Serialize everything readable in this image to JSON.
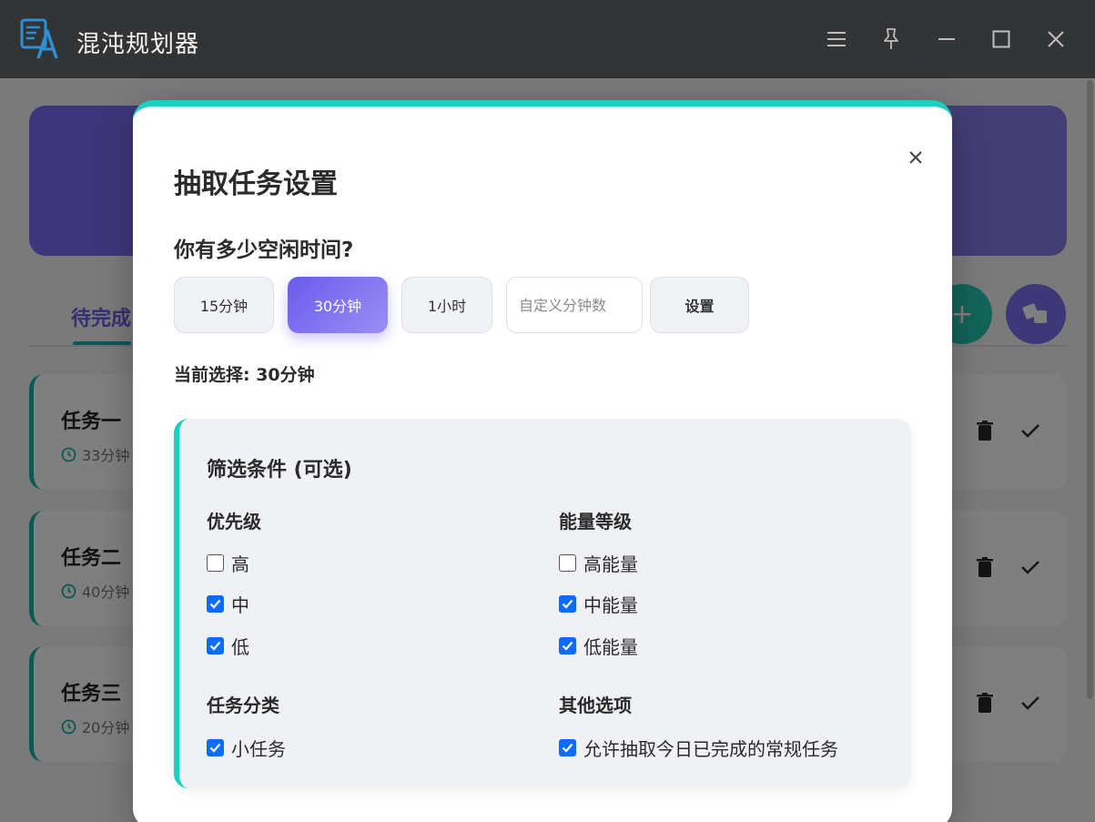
{
  "window": {
    "title": "混沌规划器",
    "controls": [
      "menu-icon",
      "pin-icon",
      "minimize-icon",
      "maximize-icon",
      "close-icon"
    ]
  },
  "background": {
    "active_tab": "待完成",
    "tasks": [
      {
        "title": "任务一",
        "duration": "33分钟"
      },
      {
        "title": "任务二",
        "duration": "40分钟"
      },
      {
        "title": "任务三",
        "duration": "20分钟"
      }
    ]
  },
  "modal": {
    "title": "抽取任务设置",
    "question": "你有多少空闲时间?",
    "time_options": [
      {
        "label": "15分钟",
        "selected": false
      },
      {
        "label": "30分钟",
        "selected": true
      },
      {
        "label": "1小时",
        "selected": false
      }
    ],
    "custom_placeholder": "自定义分钟数",
    "set_label": "设置",
    "current_selection": "当前选择: 30分钟",
    "filter": {
      "title": "筛选条件 (可选)",
      "priority": {
        "title": "优先级",
        "options": [
          {
            "label": "高",
            "checked": false
          },
          {
            "label": "中",
            "checked": true
          },
          {
            "label": "低",
            "checked": true
          }
        ]
      },
      "energy": {
        "title": "能量等级",
        "options": [
          {
            "label": "高能量",
            "checked": false
          },
          {
            "label": "中能量",
            "checked": true
          },
          {
            "label": "低能量",
            "checked": true
          }
        ]
      },
      "category": {
        "title": "任务分类",
        "options": [
          {
            "label": "小任务",
            "checked": true
          }
        ]
      },
      "other": {
        "title": "其他选项",
        "options": [
          {
            "label": "允许抽取今日已完成的常规任务",
            "checked": true
          }
        ]
      }
    }
  },
  "colors": {
    "accent_teal": "#1ccfc0",
    "accent_purple": "#6a5bed",
    "checkbox_blue": "#0b6cf5",
    "titlebar": "#333435"
  }
}
